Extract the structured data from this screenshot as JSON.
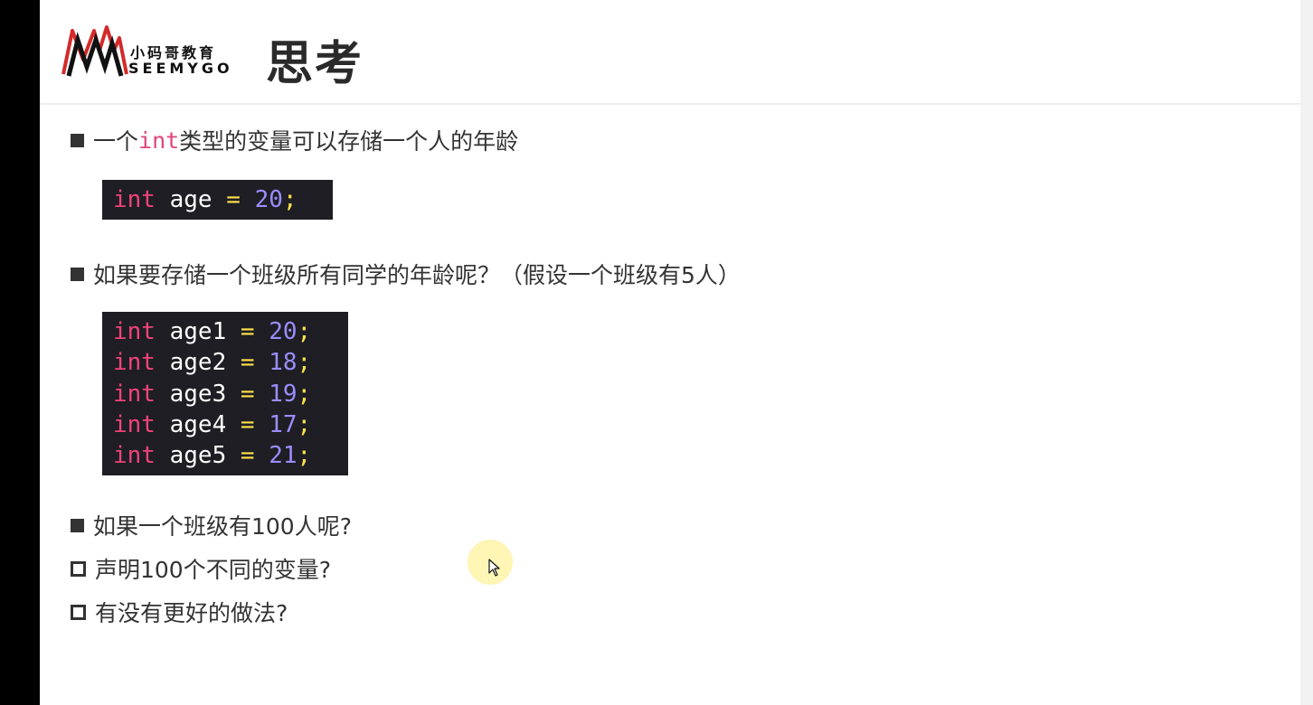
{
  "header": {
    "logo_cn": "小码哥教育",
    "logo_en": "SEEMYGO",
    "title": "思考"
  },
  "bullets": {
    "b1": {
      "pre": "一个",
      "kw": "int",
      "post": "类型的变量可以存储一个人的年龄"
    },
    "b2": "如果要存储一个班级所有同学的年龄呢？（假设一个班级有5人）",
    "b3": "如果一个班级有100人呢?",
    "b4": "声明100个不同的变量?",
    "b5": "有没有更好的做法?"
  },
  "code1": [
    {
      "type": "int",
      "name": "age",
      "eq": "=",
      "val": "20",
      "semi": ";"
    }
  ],
  "code2": [
    {
      "type": "int",
      "name": "age1",
      "eq": "=",
      "val": "20",
      "semi": ";"
    },
    {
      "type": "int",
      "name": "age2",
      "eq": "=",
      "val": "18",
      "semi": ";"
    },
    {
      "type": "int",
      "name": "age3",
      "eq": "=",
      "val": "19",
      "semi": ";"
    },
    {
      "type": "int",
      "name": "age4",
      "eq": "=",
      "val": "17",
      "semi": ";"
    },
    {
      "type": "int",
      "name": "age5",
      "eq": "=",
      "val": "21",
      "semi": ";"
    }
  ],
  "colors": {
    "keyword": "#f0437a",
    "operator": "#ffe14a",
    "number": "#9b8dff",
    "code_bg": "#1e1e24",
    "logo_red": "#d42a2a"
  }
}
